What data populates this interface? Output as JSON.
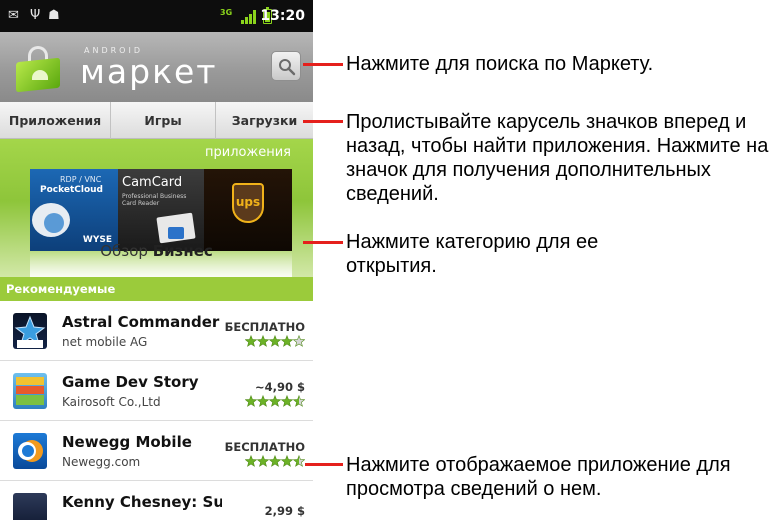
{
  "status_bar": {
    "clock": "13:20",
    "network": "3G"
  },
  "header": {
    "brand_small": "ANDROID",
    "brand_name": "маркет"
  },
  "tabs": [
    {
      "label": "Приложения"
    },
    {
      "label": "Игры"
    },
    {
      "label": "Загрузки"
    }
  ],
  "carousel": {
    "section_label": "приложения",
    "tiles": [
      {
        "line1": "RDP / VNC",
        "line2": "PocketCloud",
        "badge": "WYSE"
      },
      {
        "line1": "CamCard",
        "line2": "Professional Business Card Reader"
      },
      {
        "line1": "ups"
      }
    ],
    "category_prefix": "Обзор",
    "category_name": "Бизнес"
  },
  "featured": {
    "header": "Рекомендуемые",
    "apps": [
      {
        "name": "Astral Commander",
        "developer": "net mobile AG",
        "price": "БЕСПЛАТНО",
        "rating": 4
      },
      {
        "name": "Game Dev Story",
        "developer": "Kairosoft Co.,Ltd",
        "price": "~4,90 $",
        "rating": 4.5
      },
      {
        "name": "Newegg Mobile",
        "developer": "Newegg.com",
        "price": "БЕСПЛАТНО",
        "rating": 4.5
      },
      {
        "name": "Kenny Chesney: Summer",
        "developer": "",
        "price": "2,99 $",
        "rating": 0
      }
    ]
  },
  "callouts": {
    "search": "Нажмите для поиска по Маркету.",
    "carousel": "Пролистывайте карусель значков вперед и назад, чтобы найти приложения. Нажмите на значок для получения дополнительных сведений.",
    "category": "Нажмите категорию для ее открытия.",
    "featured": "Нажмите отображаемое приложение для просмотра сведений о нем."
  },
  "colors": {
    "accent_green": "#9bcb3b",
    "pointer_red": "#e5201c",
    "status_green": "#8bd41c"
  }
}
